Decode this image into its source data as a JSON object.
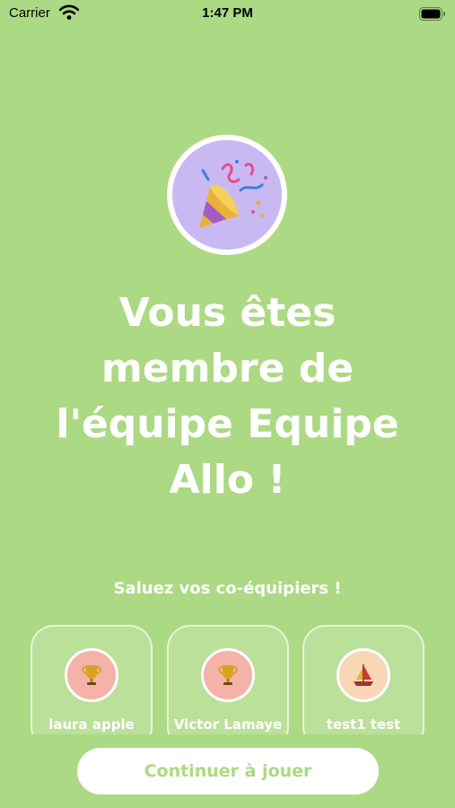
{
  "status_bar": {
    "carrier": "Carrier",
    "time": "1:47 PM"
  },
  "hero": {
    "icon": "party-popper-icon",
    "background": "#c8b9f2"
  },
  "title_lines": [
    "Vous êtes",
    "membre de",
    "l'équipe Equipe",
    "Allo !"
  ],
  "subtitle": "Saluez vos co-équipiers !",
  "teammates": [
    {
      "name": "laura apple",
      "icon": "trophy-icon",
      "avatar_color": "#f4b2a8"
    },
    {
      "name": "Victor Lamaye",
      "icon": "trophy-icon",
      "avatar_color": "#f4b2a8"
    },
    {
      "name": "test1 test",
      "icon": "sailboat-icon",
      "avatar_color": "#f8d6b6"
    }
  ],
  "continue_label": "Continuer à jouer",
  "colors": {
    "background": "#acd983",
    "accent_text": "#acd983",
    "button_bg": "#ffffff"
  }
}
